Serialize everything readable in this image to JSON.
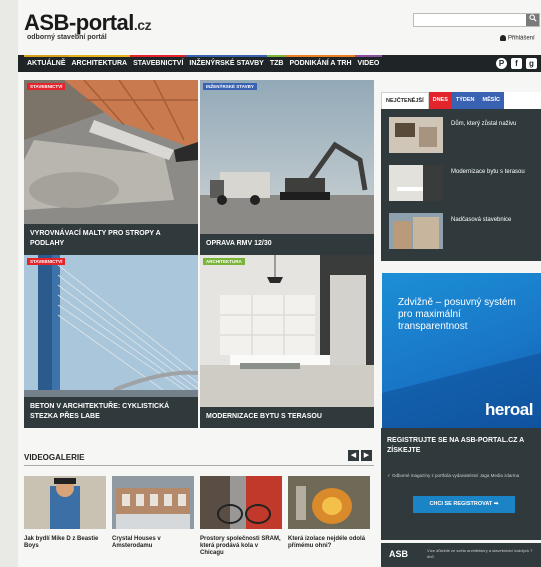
{
  "header": {
    "logo": "ASB-portal",
    "logo_suffix": ".cz",
    "subtitle": "odborný stavební portál",
    "search_placeholder": "",
    "search_icon": "search-icon",
    "login": "Přihlášení"
  },
  "nav": {
    "items": [
      {
        "label": "AKTUÁLNĚ",
        "color": "#d6a21e"
      },
      {
        "label": "ARCHITEKTURA",
        "color": "#e7b319"
      },
      {
        "label": "STAVEBNICTVÍ",
        "color": "#e3242b"
      },
      {
        "label": "INŽENÝRSKÉ STAVBY",
        "color": "#3a62b2"
      },
      {
        "label": "TZB",
        "color": "#7ab539"
      },
      {
        "label": "PODNIKÁNÍ A TRH",
        "color": "#e9801d"
      },
      {
        "label": "VIDEO",
        "color": "#8a4f9e"
      }
    ],
    "social": [
      "pinterest-icon",
      "facebook-icon",
      "googleplus-icon"
    ]
  },
  "tiles": [
    {
      "tag": "STAVEBNICTVÍ",
      "tag_color": "#e3242b",
      "caption": "VYROVNÁVACÍ MALTY PRO STROPY A PODLAHY"
    },
    {
      "tag": "INŽENÝRSKÉ STAVBY",
      "tag_color": "#3a62b2",
      "caption": "OPRAVA RMV 12/30"
    },
    {
      "tag": "STAVEBNICTVÍ",
      "tag_color": "#e3242b",
      "caption": "BETON V ARCHITEKTUŘE: CYKLISTICKÁ STEZKA PŘES LABE"
    },
    {
      "tag": "ARCHITEKTURA",
      "tag_color": "#7ab539",
      "caption": "MODERNIZACE BYTU S TERASOU"
    }
  ],
  "sidebar": {
    "tabs": [
      {
        "label": "NEJČTENĚJŠÍ",
        "color": ""
      },
      {
        "label": "DNES",
        "color": "#e3242b"
      },
      {
        "label": "TÝDEN",
        "color": "#3a62b2"
      },
      {
        "label": "MĚSÍC",
        "color": "#3a62b2"
      }
    ],
    "items": [
      {
        "title": "Dům, který zůstal naživu"
      },
      {
        "title": "Modernizace bytu s terasou"
      },
      {
        "title": "Nadčasová stavebnice"
      }
    ]
  },
  "ad": {
    "text": "Zdvižně – posuvný systém pro maximální transparentnost",
    "brand": "heroal"
  },
  "register": {
    "title": "REGISTRUJTE SE NA ASB-PORTAL.CZ A ZÍSKEJTE",
    "desc": "✓ Odborné magazíny z portfolia vydavatelství Jaga Media zdarma",
    "button": "CHCI SE REGISTROVAT ➡"
  },
  "footbox": {
    "logo": "ASB",
    "text": "Více důležité ze světa architektury a stavebnictví každých 7 dnů"
  },
  "videogallery": {
    "title": "VIDEOGALERIE",
    "prev": "◀",
    "next": "▶",
    "items": [
      {
        "caption": "Jak bydlí Mike D z Beastie Boys"
      },
      {
        "caption": "Crystal Houses v Amsterodamu"
      },
      {
        "caption": "Prostory společnosti SRAM, která prodává kola v Chicagu"
      },
      {
        "caption": "Která izolace nejdéle odolá přímému ohni?"
      }
    ]
  }
}
